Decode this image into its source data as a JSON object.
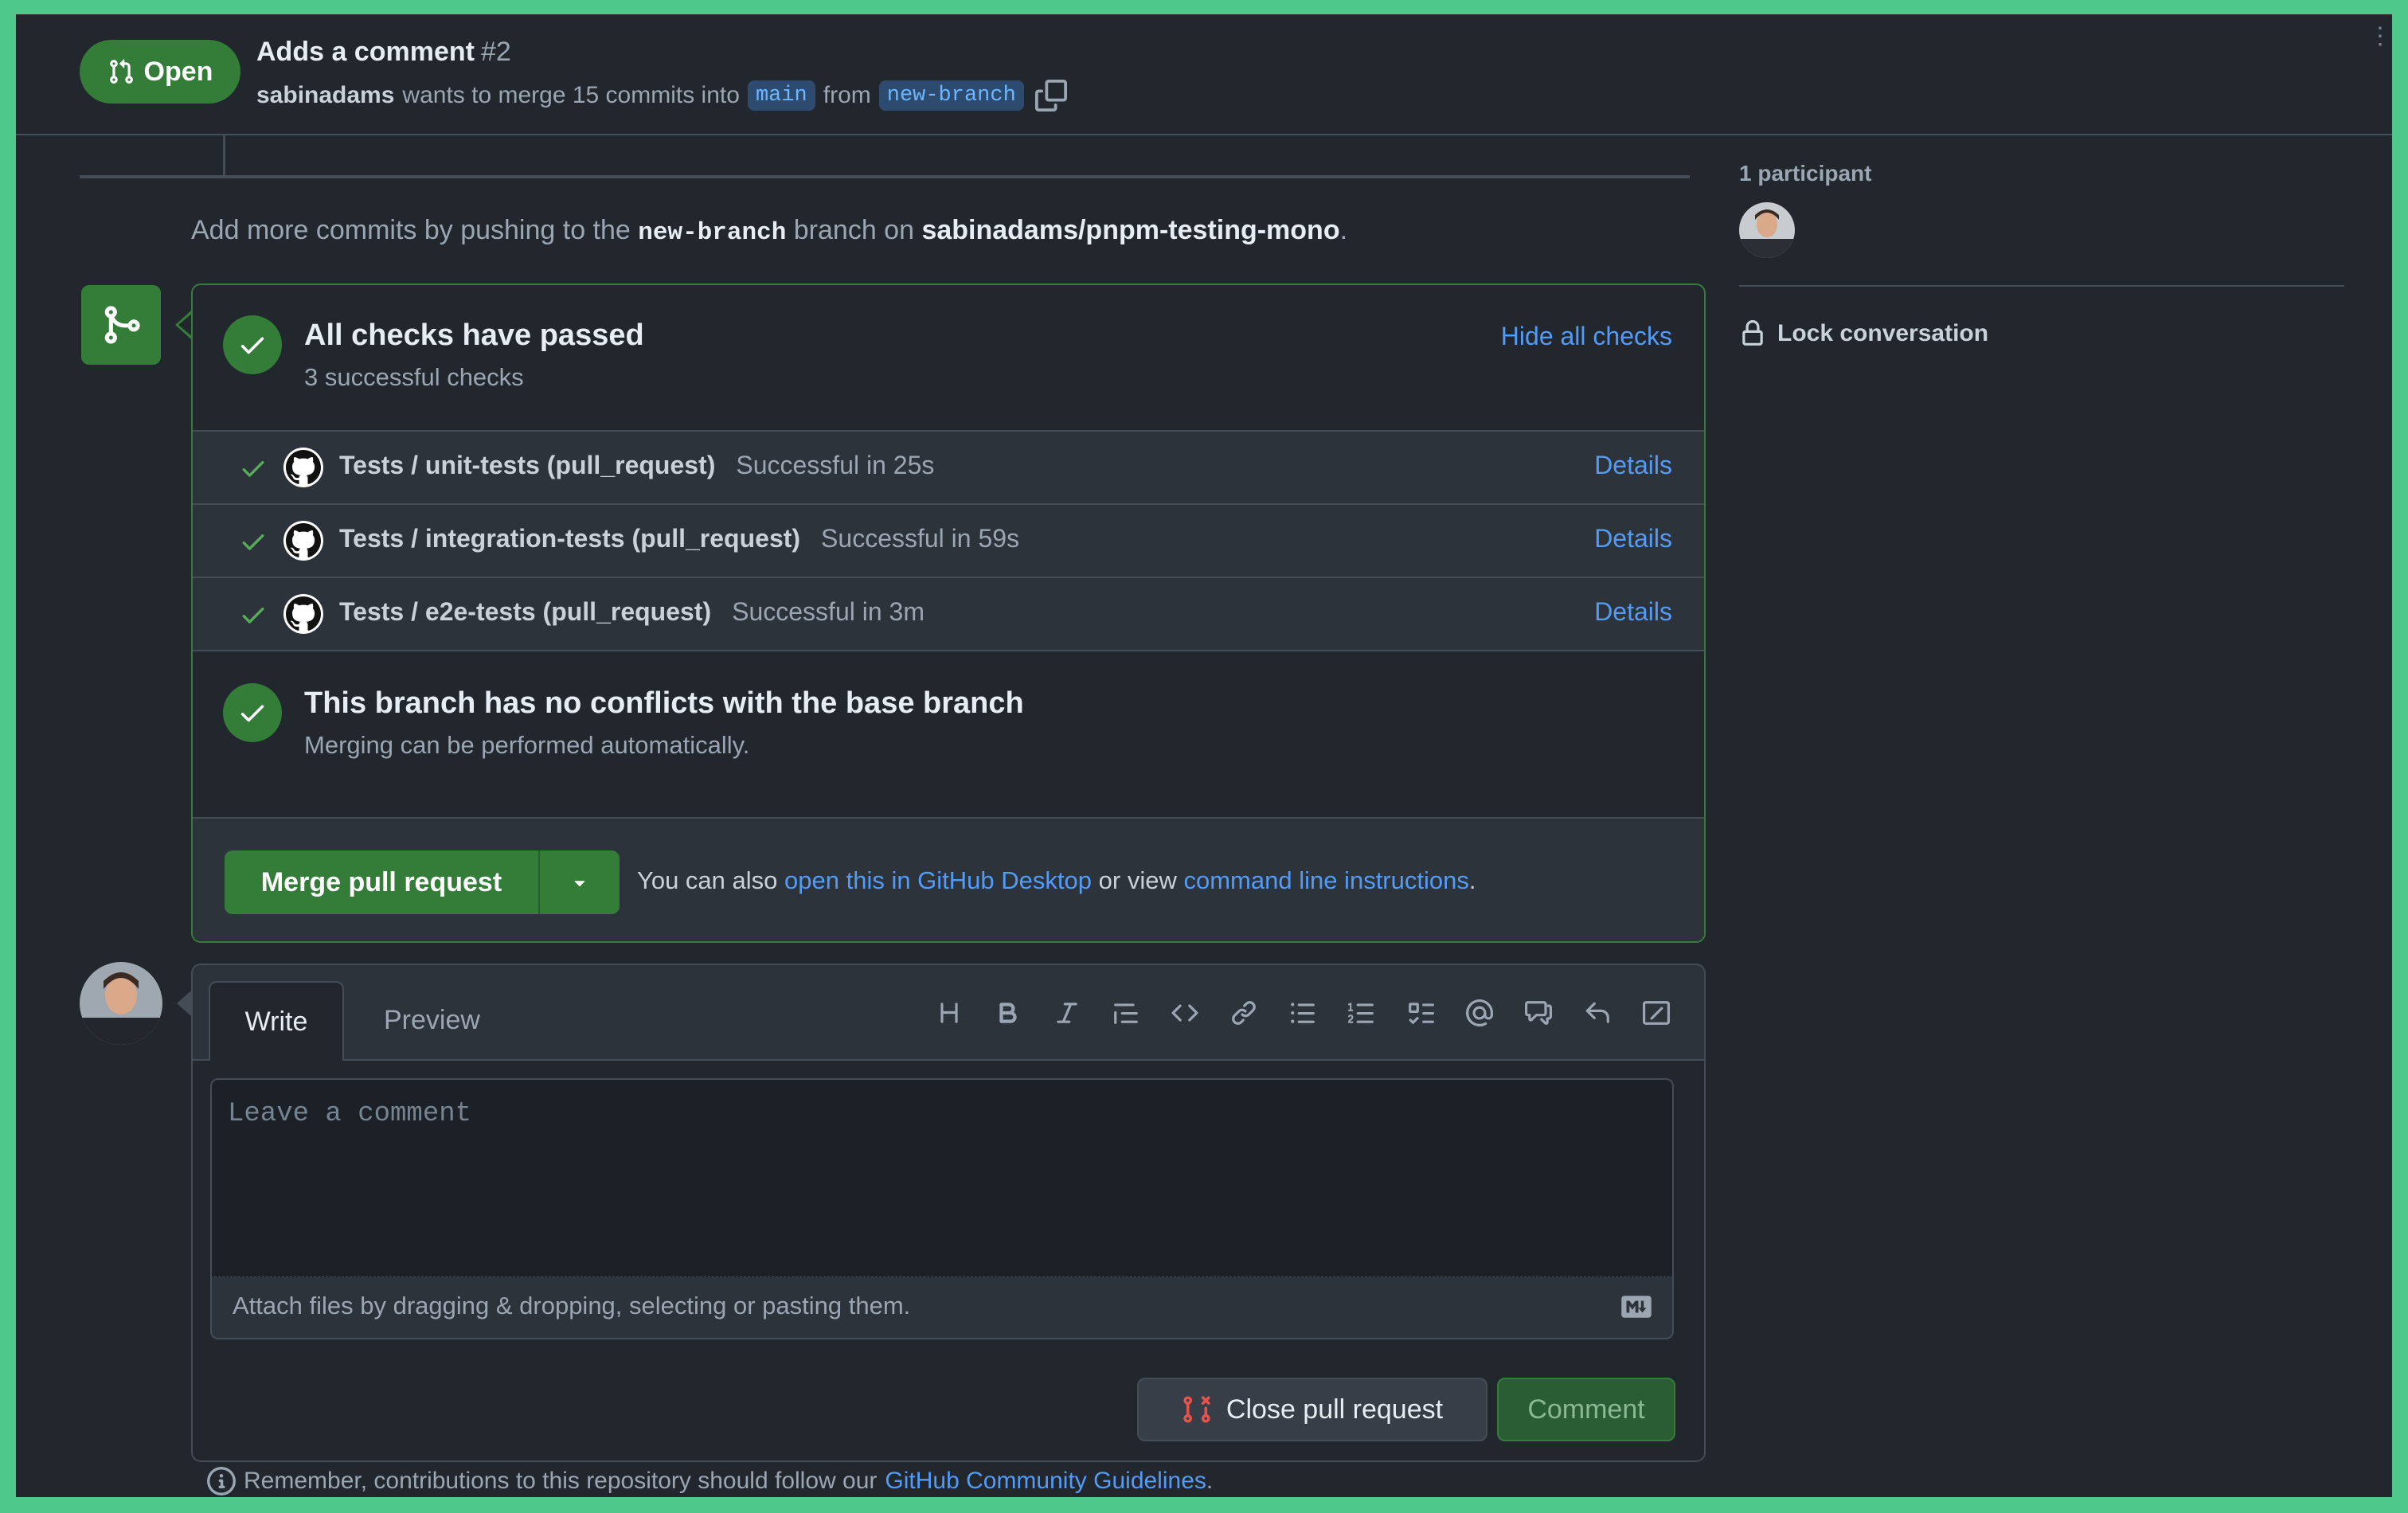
{
  "header": {
    "status": "Open",
    "title": "Adds a comment",
    "number": "#2",
    "author": "sabinadams",
    "merge_text": "wants to merge 15 commits into",
    "base_branch": "main",
    "from_text": "from",
    "head_branch": "new-branch"
  },
  "push_hint": {
    "prefix": "Add more commits by pushing to the",
    "branch": "new-branch",
    "middle": "branch on",
    "repo": "sabinadams/pnpm-testing-mono",
    "suffix": "."
  },
  "checks": {
    "title": "All checks have passed",
    "subtitle": "3 successful checks",
    "toggle_label": "Hide all checks",
    "items": [
      {
        "name": "Tests / unit-tests (pull_request)",
        "status": "Successful in 25s",
        "action": "Details"
      },
      {
        "name": "Tests / integration-tests (pull_request)",
        "status": "Successful in 59s",
        "action": "Details"
      },
      {
        "name": "Tests / e2e-tests (pull_request)",
        "status": "Successful in 3m",
        "action": "Details"
      }
    ]
  },
  "conflicts": {
    "title": "This branch has no conflicts with the base branch",
    "subtitle": "Merging can be performed automatically."
  },
  "merge": {
    "button_label": "Merge pull request",
    "note_prefix": "You can also",
    "desktop_link": "open this in GitHub Desktop",
    "note_middle": "or view",
    "cli_link": "command line instructions",
    "note_suffix": "."
  },
  "sidebar": {
    "participants_label": "1 participant",
    "lock_label": "Lock conversation"
  },
  "comment": {
    "tab_write": "Write",
    "tab_preview": "Preview",
    "placeholder": "Leave a comment",
    "attach_text": "Attach files by dragging & dropping, selecting or pasting them.",
    "close_label": "Close pull request",
    "comment_label": "Comment"
  },
  "reminder": {
    "prefix": "Remember, contributions to this repository should follow our",
    "link": "GitHub Community Guidelines",
    "suffix": "."
  },
  "colors": {
    "accent_green": "#347d39",
    "link_blue": "#539bf5",
    "background": "#22272e",
    "frame": "#4ec98b"
  }
}
